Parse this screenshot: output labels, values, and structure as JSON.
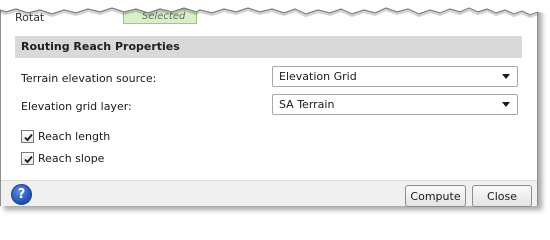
{
  "top": {
    "label": "Rotat",
    "tag": "Selected"
  },
  "section": {
    "title": "Routing Reach Properties"
  },
  "fields": {
    "terrain_source": {
      "label": "Terrain elevation source:",
      "value": "Elevation Grid"
    },
    "grid_layer": {
      "label": "Elevation grid layer:",
      "value": "SA Terrain"
    }
  },
  "checkboxes": {
    "reach_length": {
      "label": "Reach length",
      "checked": true
    },
    "reach_slope": {
      "label": "Reach slope",
      "checked": true
    }
  },
  "footer": {
    "help_glyph": "?",
    "compute_label": "Compute",
    "close_label": "Close"
  },
  "colors": {
    "section_bg": "#d9d9d9",
    "tag_bg": "#d7f0c7",
    "help_blue": "#1d4fb3"
  }
}
